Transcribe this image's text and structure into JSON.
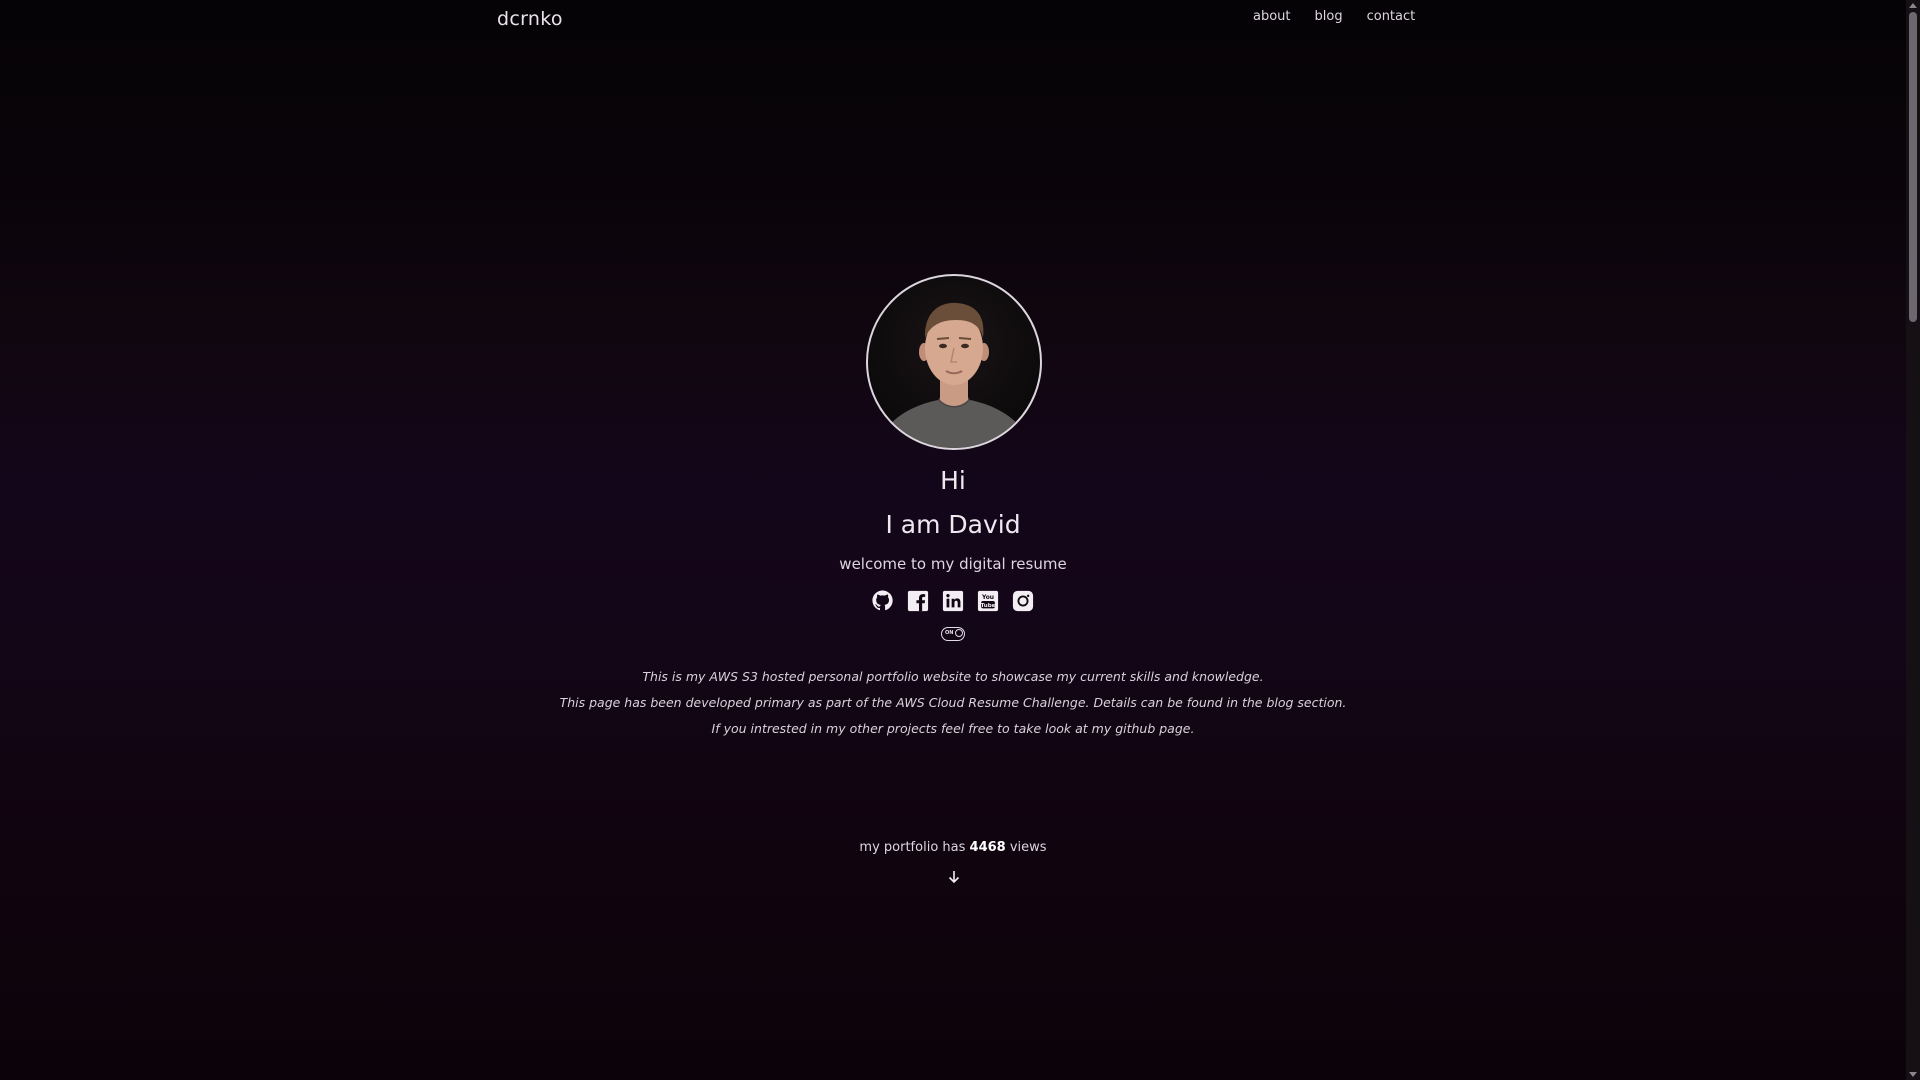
{
  "nav": {
    "brand": "dcrnko",
    "links": [
      "about",
      "blog",
      "contact"
    ]
  },
  "hero": {
    "greeting": "Hi",
    "title": "I am David",
    "subtitle": "welcome to my digital resume",
    "socials": [
      "github-icon",
      "facebook-icon",
      "linkedin-icon",
      "youtube-icon",
      "instagram-icon"
    ],
    "theme_toggle": "ON"
  },
  "description": [
    "This is my AWS S3 hosted personal portfolio website to showcase my current skills and knowledge.",
    "This page has been developed primary as part of the AWS Cloud Resume Challenge. Details can be found in the blog section.",
    "If you intrested in my other projects feel free to take look at my github page."
  ],
  "views": {
    "prefix": "my portfolio has",
    "count": "4468",
    "suffix": "views"
  },
  "colors": {
    "background_top": "#060306",
    "background_mid": "#14061a",
    "text": "#ece6ef"
  }
}
